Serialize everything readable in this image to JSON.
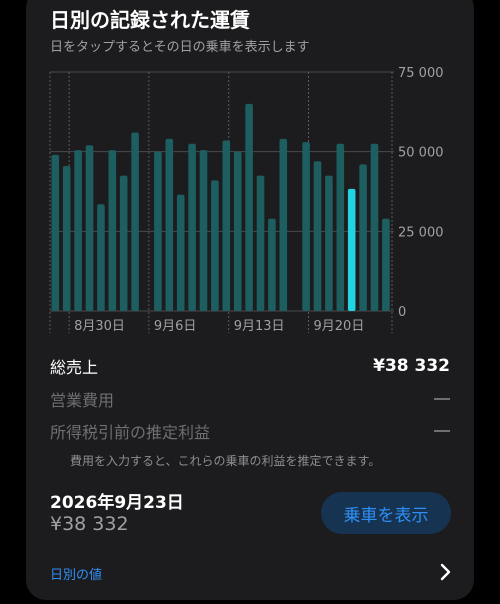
{
  "header": {
    "title": "日別の記録された運賃",
    "subtitle": "日をタップするとその日の乗車を表示します"
  },
  "chart_data": {
    "type": "bar",
    "days": [
      {
        "day": 1,
        "value": 49000
      },
      {
        "day": 2,
        "value": 45500
      },
      {
        "day": 3,
        "value": 50500
      },
      {
        "day": 4,
        "value": 52000
      },
      {
        "day": 5,
        "value": 33500
      },
      {
        "day": 6,
        "value": 50500
      },
      {
        "day": 7,
        "value": 42500
      },
      {
        "day": 8,
        "value": 56000
      },
      {
        "day": 9,
        "value": null
      },
      {
        "day": 10,
        "value": 50000
      },
      {
        "day": 11,
        "value": 54000
      },
      {
        "day": 12,
        "value": 36500
      },
      {
        "day": 13,
        "value": 52500
      },
      {
        "day": 14,
        "value": 50500
      },
      {
        "day": 15,
        "value": 41000
      },
      {
        "day": 16,
        "value": 53500
      },
      {
        "day": 17,
        "value": 50000
      },
      {
        "day": 18,
        "value": 65000
      },
      {
        "day": 19,
        "value": 42500
      },
      {
        "day": 20,
        "value": 29000
      },
      {
        "day": 21,
        "value": 54000
      },
      {
        "day": 22,
        "value": null
      },
      {
        "day": 23,
        "value": 53000
      },
      {
        "day": 24,
        "value": 47000
      },
      {
        "day": 25,
        "value": 42500
      },
      {
        "day": 26,
        "value": 52500
      },
      {
        "day": 27,
        "value": 38332
      },
      {
        "day": 28,
        "value": 46000
      },
      {
        "day": 29,
        "value": 52500
      },
      {
        "day": 30,
        "value": 29000
      }
    ],
    "selected_day": 27,
    "x_tick_labels": [
      {
        "label": "8月30日",
        "day": 2
      },
      {
        "label": "9月6日",
        "day": 9
      },
      {
        "label": "9月13日",
        "day": 16
      },
      {
        "label": "9月20日",
        "day": 23
      }
    ],
    "y_ticks": [
      {
        "value": 75000,
        "label": "75 000"
      },
      {
        "value": 50000,
        "label": "50 000"
      },
      {
        "value": 25000,
        "label": "25 000"
      },
      {
        "value": 0,
        "label": "0"
      }
    ],
    "ylim": [
      0,
      75000
    ],
    "colors": {
      "bar": "#1d5e61",
      "selected": "#22d3e0",
      "grid": "#4a4a4e"
    }
  },
  "summary": {
    "total_sales_label": "総売上",
    "total_sales_value": "¥38 332",
    "operating_cost_label": "営業費用",
    "pretax_profit_label": "所得税引前の推定利益",
    "note": "費用を入力すると、これらの乗車の利益を推定できます。"
  },
  "selection": {
    "date": "2026年9月23日",
    "value": "¥38 332",
    "show_rides_button": "乗車を表示"
  },
  "footer": {
    "daily_values_link": "日別の値"
  }
}
